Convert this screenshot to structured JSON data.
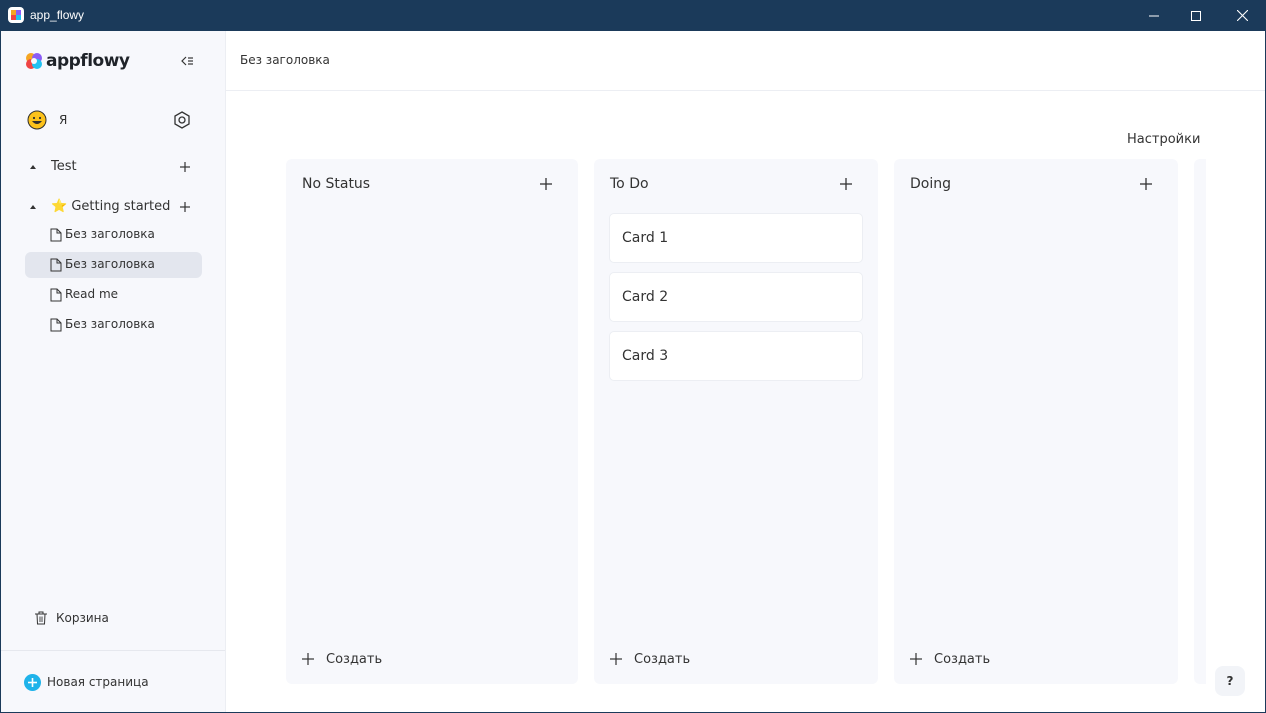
{
  "window": {
    "title": "app_flowy",
    "controls": [
      "minimize-icon",
      "maximize-icon",
      "close-icon"
    ]
  },
  "sidebar": {
    "logo_text": "appflowy",
    "user": {
      "name": "Я",
      "avatar": "grinning-face-emoji"
    },
    "sections": [
      {
        "label": "Test",
        "expanded": true
      },
      {
        "label": "⭐ Getting started",
        "expanded": true
      }
    ],
    "pages": [
      {
        "label": "Без заголовка",
        "active": false
      },
      {
        "label": "Без заголовка",
        "active": true
      },
      {
        "label": "Read me",
        "active": false
      },
      {
        "label": "Без заголовка",
        "active": false
      }
    ],
    "trash_label": "Корзина",
    "new_page_label": "Новая страница"
  },
  "header": {
    "breadcrumb": "Без заголовка"
  },
  "board": {
    "settings_label": "Настройки",
    "columns": [
      {
        "title": "No Status",
        "cards": [],
        "create_label": "Создать"
      },
      {
        "title": "To Do",
        "cards": [
          "Card 1",
          "Card 2",
          "Card 3"
        ],
        "create_label": "Создать"
      },
      {
        "title": "Doing",
        "cards": [],
        "create_label": "Создать"
      }
    ]
  },
  "help_label": "?",
  "colors": {
    "titlebar": "#1b3a5a",
    "sidebar_bg": "#f7f8fc",
    "active_page_bg": "#e3e6ee",
    "accent": "#1fb3ea"
  }
}
